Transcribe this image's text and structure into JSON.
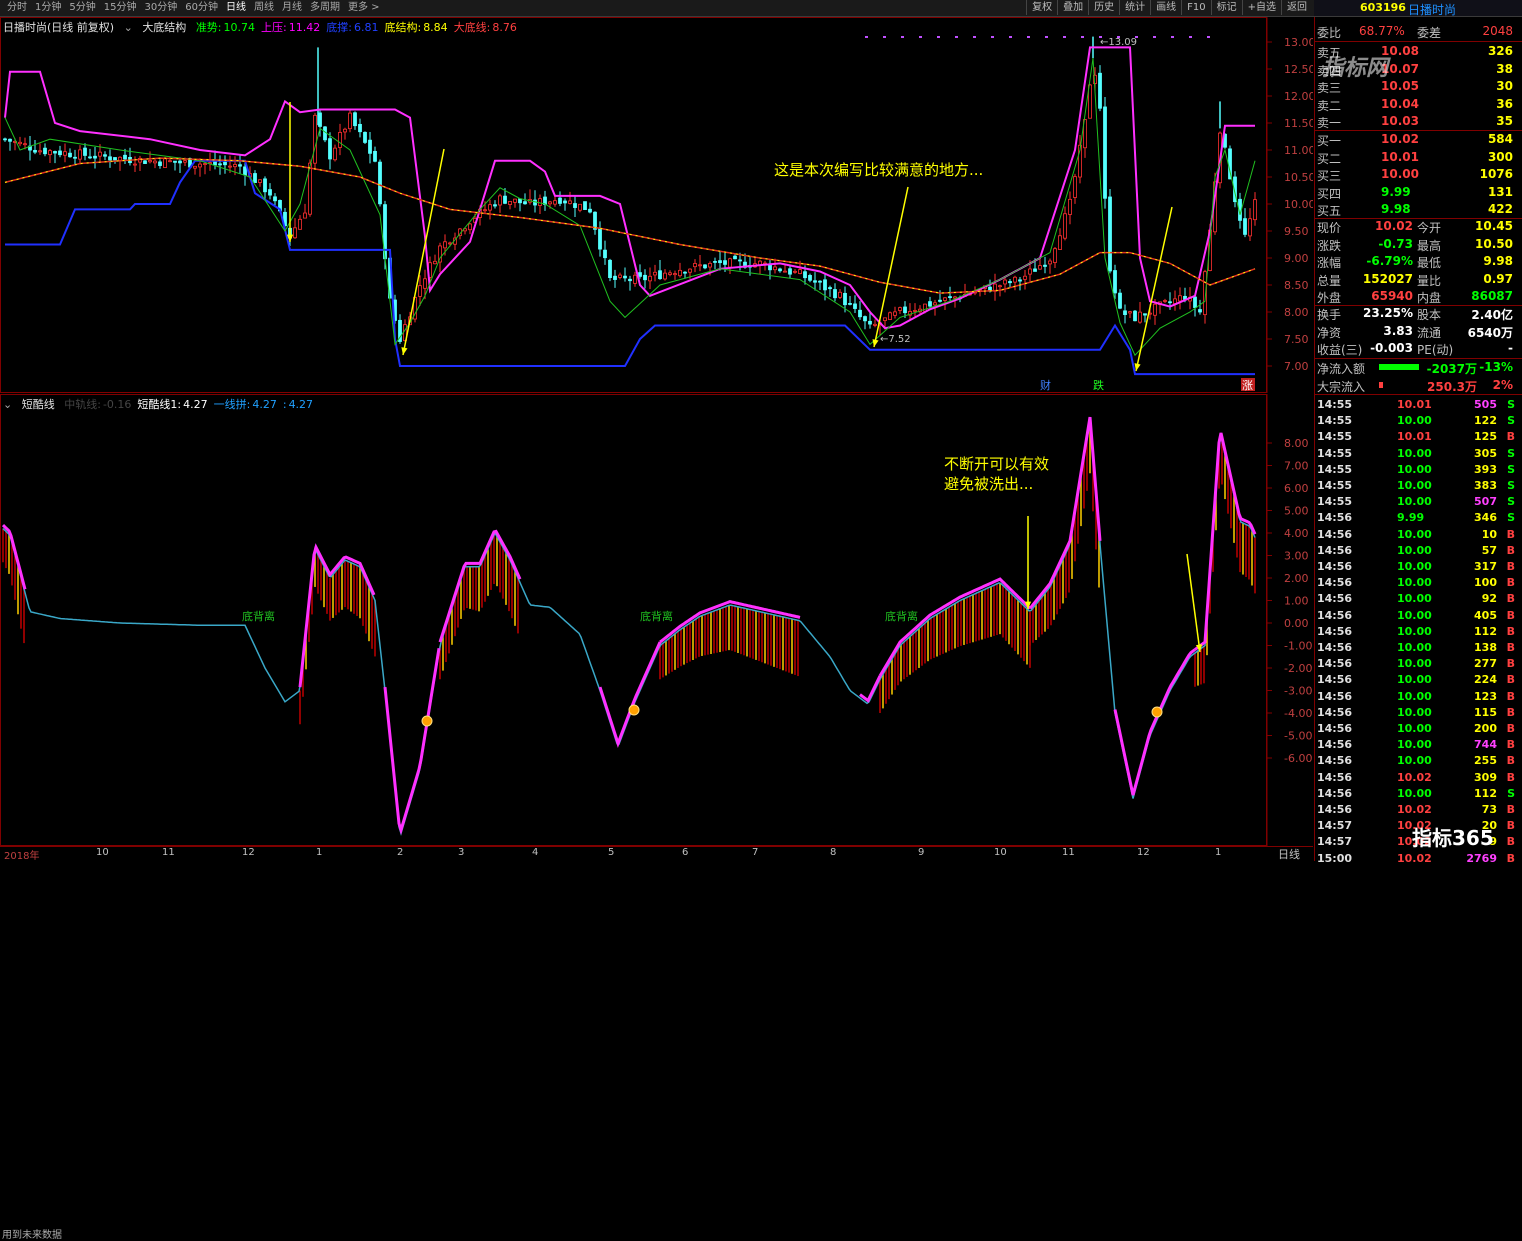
{
  "toolbar": {
    "periods": [
      "分时",
      "1分钟",
      "5分钟",
      "15分钟",
      "30分钟",
      "60分钟",
      "日线",
      "周线",
      "月线",
      "多周期",
      "更多 >"
    ],
    "active_period": "日线",
    "tools": [
      "复权",
      "叠加",
      "历史",
      "统计",
      "画线",
      "F10",
      "标记",
      "+自选",
      "返回"
    ]
  },
  "stock": {
    "code": "603196",
    "name": "日播时尚"
  },
  "main_chart": {
    "header": {
      "title": "日播时尚(日线 前复权)",
      "indicator_name": "大底结构",
      "values": [
        {
          "label": "准势:",
          "value": "10.74",
          "color": "#00ff00"
        },
        {
          "label": "上压:",
          "value": "11.42",
          "color": "#ff00ff"
        },
        {
          "label": "底撑:",
          "value": "6.81",
          "color": "#2040ff"
        },
        {
          "label": "底结构:",
          "value": "8.84",
          "color": "#ffff00"
        },
        {
          "label": "大底线:",
          "value": "8.76",
          "color": "#ff4040"
        }
      ]
    },
    "annotation": "这是本次编写比较满意的地方...",
    "price_labels": [
      "13.00",
      "12.50",
      "12.00",
      "11.50",
      "11.00",
      "10.50",
      "10.00",
      "9.50",
      "9.00",
      "8.50",
      "8.00",
      "7.50",
      "7.00"
    ],
    "high_mark": "13.09",
    "low_mark": "7.52",
    "event_markers": [
      "财",
      "跌",
      "涨"
    ]
  },
  "sub_chart": {
    "header": {
      "name": "短酷线",
      "extras": [
        {
          "label": "中轨线:",
          "value": "-0.16",
          "color": "#444444"
        },
        {
          "label": "短酷线1:",
          "value": "4.27",
          "color": "#ffffff"
        },
        {
          "label": "一线拼:",
          "value": "4.27",
          "color": "#20a0ff"
        },
        {
          "label": ":",
          "value": "4.27",
          "color": "#20a0ff"
        }
      ]
    },
    "annotation": "不断开可以有效\n避免被洗出...",
    "labels": [
      "底背离",
      "底背离",
      "底背离"
    ],
    "value_labels": [
      "8.00",
      "7.00",
      "6.00",
      "5.00",
      "4.00",
      "3.00",
      "2.00",
      "1.00",
      "0.00",
      "-1.00",
      "-2.00",
      "-3.00",
      "-4.00",
      "-5.00",
      "-6.00"
    ],
    "note": "用到未来数据"
  },
  "date_axis": [
    "2018年",
    "10",
    "11",
    "12",
    "1",
    "2",
    "3",
    "4",
    "5",
    "6",
    "7",
    "8",
    "9",
    "10",
    "11",
    "12",
    "1"
  ],
  "period_label": "日线",
  "quote": {
    "weibi": {
      "label": "委比",
      "pct": "68.77%",
      "label2": "委差",
      "value": "2048"
    },
    "sells": [
      {
        "label": "卖五",
        "price": "10.08",
        "vol": "326"
      },
      {
        "label": "卖四",
        "price": "10.07",
        "vol": "38"
      },
      {
        "label": "卖三",
        "price": "10.05",
        "vol": "30"
      },
      {
        "label": "卖二",
        "price": "10.04",
        "vol": "36"
      },
      {
        "label": "卖一",
        "price": "10.03",
        "vol": "35"
      }
    ],
    "buys": [
      {
        "label": "买一",
        "price": "10.02",
        "vol": "584"
      },
      {
        "label": "买二",
        "price": "10.01",
        "vol": "300"
      },
      {
        "label": "买三",
        "price": "10.00",
        "vol": "1076"
      },
      {
        "label": "买四",
        "price": "9.99",
        "vol": "131"
      },
      {
        "label": "买五",
        "price": "9.98",
        "vol": "422"
      }
    ],
    "stats": [
      {
        "l1": "现价",
        "v1": "10.02",
        "c1": "#ff4040",
        "l2": "今开",
        "v2": "10.45",
        "c2": "#ffff00"
      },
      {
        "l1": "涨跌",
        "v1": "-0.73",
        "c1": "#00ff00",
        "l2": "最高",
        "v2": "10.50",
        "c2": "#ffff00"
      },
      {
        "l1": "涨幅",
        "v1": "-6.79%",
        "c1": "#00ff00",
        "l2": "最低",
        "v2": "9.98",
        "c2": "#ffff00"
      },
      {
        "l1": "总量",
        "v1": "152027",
        "c1": "#ffff00",
        "l2": "量比",
        "v2": "0.97",
        "c2": "#ffff00"
      },
      {
        "l1": "外盘",
        "v1": "65940",
        "c1": "#ff4040",
        "l2": "内盘",
        "v2": "86087",
        "c2": "#00ff00"
      }
    ],
    "stats2": [
      {
        "l1": "换手",
        "v1": "23.25%",
        "l2": "股本",
        "v2": "2.40亿"
      },
      {
        "l1": "净资",
        "v1": "3.83",
        "l2": "流通",
        "v2": "6540万"
      },
      {
        "l1": "收益(三)",
        "v1": "-0.003",
        "l2": "PE(动)",
        "v2": "-"
      }
    ],
    "flow": [
      {
        "label": "净流入额",
        "value": "-2037万",
        "pct": "-13%",
        "color": "#00ff00"
      },
      {
        "label": "大宗流入",
        "value": "250.3万",
        "pct": "2%",
        "color": "#ff4040"
      }
    ],
    "trades": [
      {
        "t": "14:55",
        "p": "10.01",
        "v": "505",
        "s": "S"
      },
      {
        "t": "14:55",
        "p": "10.00",
        "v": "122",
        "s": "S"
      },
      {
        "t": "14:55",
        "p": "10.01",
        "v": "125",
        "s": "B"
      },
      {
        "t": "14:55",
        "p": "10.00",
        "v": "305",
        "s": "S"
      },
      {
        "t": "14:55",
        "p": "10.00",
        "v": "393",
        "s": "S"
      },
      {
        "t": "14:55",
        "p": "10.00",
        "v": "383",
        "s": "S"
      },
      {
        "t": "14:55",
        "p": "10.00",
        "v": "507",
        "s": "S"
      },
      {
        "t": "14:56",
        "p": "9.99",
        "v": "346",
        "s": "S"
      },
      {
        "t": "14:56",
        "p": "10.00",
        "v": "10",
        "s": "B"
      },
      {
        "t": "14:56",
        "p": "10.00",
        "v": "57",
        "s": "B"
      },
      {
        "t": "14:56",
        "p": "10.00",
        "v": "317",
        "s": "B"
      },
      {
        "t": "14:56",
        "p": "10.00",
        "v": "100",
        "s": "B"
      },
      {
        "t": "14:56",
        "p": "10.00",
        "v": "92",
        "s": "B"
      },
      {
        "t": "14:56",
        "p": "10.00",
        "v": "405",
        "s": "B"
      },
      {
        "t": "14:56",
        "p": "10.00",
        "v": "112",
        "s": "B"
      },
      {
        "t": "14:56",
        "p": "10.00",
        "v": "138",
        "s": "B"
      },
      {
        "t": "14:56",
        "p": "10.00",
        "v": "277",
        "s": "B"
      },
      {
        "t": "14:56",
        "p": "10.00",
        "v": "224",
        "s": "B"
      },
      {
        "t": "14:56",
        "p": "10.00",
        "v": "123",
        "s": "B"
      },
      {
        "t": "14:56",
        "p": "10.00",
        "v": "115",
        "s": "B"
      },
      {
        "t": "14:56",
        "p": "10.00",
        "v": "200",
        "s": "B"
      },
      {
        "t": "14:56",
        "p": "10.00",
        "v": "744",
        "s": "B"
      },
      {
        "t": "14:56",
        "p": "10.00",
        "v": "255",
        "s": "B"
      },
      {
        "t": "14:56",
        "p": "10.02",
        "v": "309",
        "s": "B"
      },
      {
        "t": "14:56",
        "p": "10.00",
        "v": "112",
        "s": "S"
      },
      {
        "t": "14:56",
        "p": "10.02",
        "v": "73",
        "s": "B"
      },
      {
        "t": "14:57",
        "p": "10.02",
        "v": "20",
        "s": "B"
      },
      {
        "t": "14:57",
        "p": "10.02",
        "v": "9",
        "s": "B"
      },
      {
        "t": "15:00",
        "p": "10.02",
        "v": "2769",
        "s": "B"
      }
    ]
  },
  "watermarks": {
    "top": "指标网",
    "bottom": "指标365"
  }
}
